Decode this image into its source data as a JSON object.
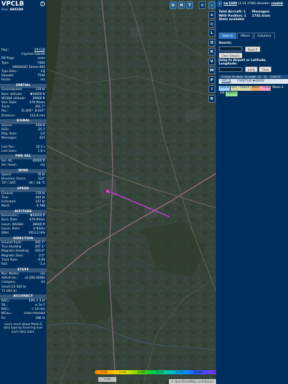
{
  "infoblock": {
    "title": "VPCLB",
    "hex_label": "Hex:",
    "hex": "4901D8",
    "close_icon": "close-icon",
    "rows_top": [
      {
        "k": "Reg.:",
        "v": "VP-CLB",
        "link": true
      },
      {
        "k": "",
        "v": "Cayman Islands"
      },
      {
        "k": "DB flags:",
        "v": "none"
      },
      {
        "k": "Type:",
        "v": "F900"
      },
      {
        "k": "",
        "v": "DASSAULT Falcon 900"
      },
      {
        "k": "Type Desc.:",
        "v": "L3J"
      },
      {
        "k": "Squawk:",
        "v": "7546"
      },
      {
        "k": "Route:",
        "v": "n/a"
      }
    ],
    "sections": [
      {
        "title": "SPATIAL",
        "rows": [
          {
            "k": "Groundspeed:",
            "v": "378 kt"
          },
          {
            "k": "Baro. altitude:",
            "v": "▼40000 ft"
          },
          {
            "k": "WGS84 altitude:",
            "v": "39900 ft"
          },
          {
            "k": "Vert. Rate:",
            "v": "-576 ft/min"
          },
          {
            "k": "Track:",
            "v": "291.7°"
          },
          {
            "k": "Pos.:",
            "v": "51.835°, 8.037°"
          },
          {
            "k": "Distance:",
            "v": "111.6 nmi"
          }
        ]
      },
      {
        "title": "SIGNAL",
        "rows": [
          {
            "k": "Source:",
            "v": "ADS-B"
          },
          {
            "k": "RSSI:",
            "v": "-25.7"
          },
          {
            "k": "Msg. Rate:",
            "v": "3.0"
          },
          {
            "k": "Messages:",
            "v": "415"
          },
          {
            "k": "",
            "v": ""
          },
          {
            "k": "Last Pos.:",
            "v": "10.5 s"
          },
          {
            "k": "Last Seen:",
            "v": "1.6 s"
          }
        ]
      },
      {
        "title": "FMS SEL",
        "rows": [
          {
            "k": "Sel. Alt.:",
            "v": "40000 ft"
          },
          {
            "k": "Sel. Head.:",
            "v": "n/a"
          }
        ]
      },
      {
        "title": "WIND",
        "rows": [
          {
            "k": "Speed:",
            "v": "76 kt"
          },
          {
            "k": "Direction (from):",
            "v": "323°"
          },
          {
            "k": "TAT / OAT:",
            "v": "-26 / -64 °C"
          }
        ]
      },
      {
        "title": "SPEED",
        "rows": [
          {
            "k": "Ground:",
            "v": "378 kt"
          },
          {
            "k": "True:",
            "v": "444 kt"
          },
          {
            "k": "Indicated:",
            "v": "237 kt"
          },
          {
            "k": "Mach:",
            "v": "0.788"
          }
        ]
      },
      {
        "title": "ALTITUDE",
        "rows": [
          {
            "k": "Barometric:",
            "v": "▼40000 ft"
          },
          {
            "k": "Baro. Rate:",
            "v": "-576 ft/min"
          },
          {
            "k": "Geom. WGS84:",
            "v": "39900 ft"
          },
          {
            "k": "Geom. Rate:",
            "v": "0 ft/min"
          },
          {
            "k": "QNH:",
            "v": "1013.2 hPa"
          }
        ]
      },
      {
        "title": "DIRECTION",
        "rows": [
          {
            "k": "Ground Track:",
            "v": "291.7°"
          },
          {
            "k": "True Heading:",
            "v": "297.1°"
          },
          {
            "k": "Magnetic Heading:",
            "v": "293.6°"
          },
          {
            "k": "Magnetic Decl.:",
            "v": "3.5°"
          },
          {
            "k": "Track Rate:",
            "v": "-0.09"
          },
          {
            "k": "Roll:",
            "v": "-1.4"
          }
        ]
      },
      {
        "title": "STUFF",
        "rows": [
          {
            "k": "Nav. Modes:",
            "v": "n/a"
          },
          {
            "k": "ADS-B Ver.:",
            "v": "v2 (DO-260B)"
          },
          {
            "k": "Category:",
            "v": "A2"
          },
          {
            "k": "Small (15 500 to",
            "v": ""
          },
          {
            "k": "75 000 lb)",
            "v": ""
          }
        ]
      },
      {
        "title": "ACCURACY",
        "rows": [
          {
            "k": "NACₚ:",
            "v": "EPU < 3 m"
          },
          {
            "k": "SIL:",
            "v": "≤ 1e-7"
          },
          {
            "k": "NACᵥ:",
            "v": "< 10 m/s"
          },
          {
            "k": "NICʙₐᵣₒ:",
            "v": "cross-checked"
          },
          {
            "k": "Rᴄ:",
            "v": "186 m"
          }
        ]
      }
    ],
    "footer": "Learn more about Mode-S data type by hovering over each data label."
  },
  "map": {
    "tool_buttons_top": [
      "U",
      "H",
      "T"
    ],
    "tool_buttons_col": [
      "L",
      "O",
      "K",
      "V",
      "M",
      "P",
      "I",
      "R"
    ],
    "legend_labels": [
      "1 000",
      "2 000",
      "4 000",
      "6 000",
      "10 000",
      "20 000",
      "30 000",
      "40 000+"
    ],
    "scale": "2 NM",
    "attribution": "© OpenStreetMap contributors",
    "zoom_in": "+",
    "zoom_out": "−",
    "colors": {
      "track": "#d040e8",
      "aircraft": "#ff5cf0"
    }
  },
  "sidebar": {
    "version_prefix": "tar1090",
    "version_rest": " (3.14.1784) decoder: ",
    "version_link": "readsb",
    "stats": [
      "Total Aircraft: 1",
      "With Position: 1",
      "Stats available"
    ],
    "messages_label": "Messages:",
    "messages_value": "1732.3/sec",
    "tabs": [
      "Search",
      "Filters",
      "Columns"
    ],
    "search_label": "Search:",
    "search_button": "Search",
    "clear_search": "Clear Search",
    "jump_label": "Jump to Airport or Latitude, Longitude:",
    "jump_button": "Jump",
    "clear_button": "Clear",
    "table_headers": [
      "",
      "Callsign",
      "Route",
      "Type",
      "Squawk",
      "Alt. (ft)",
      "Sp.",
      "Dist.",
      "RSSI"
    ],
    "table_row": [
      "",
      "VPCLB",
      "",
      "F900",
      "7546",
      "▼40000",
      "",
      "",
      ""
    ],
    "filter_chips": [
      {
        "label": "ADS-B",
        "bg": "#9bd1ff"
      },
      {
        "label": "UAT / ADS-R",
        "bg": "#d9d9a0"
      },
      {
        "label": "MLAT",
        "bg": "#f3a86b"
      },
      {
        "label": "TIS-B",
        "bg": "#f39ec5"
      },
      {
        "label": "Mode-S",
        "bg": ""
      },
      {
        "label": "AIS",
        "bg": ""
      },
      {
        "label": "ADS-C",
        "bg": "#8fe28f"
      }
    ]
  }
}
